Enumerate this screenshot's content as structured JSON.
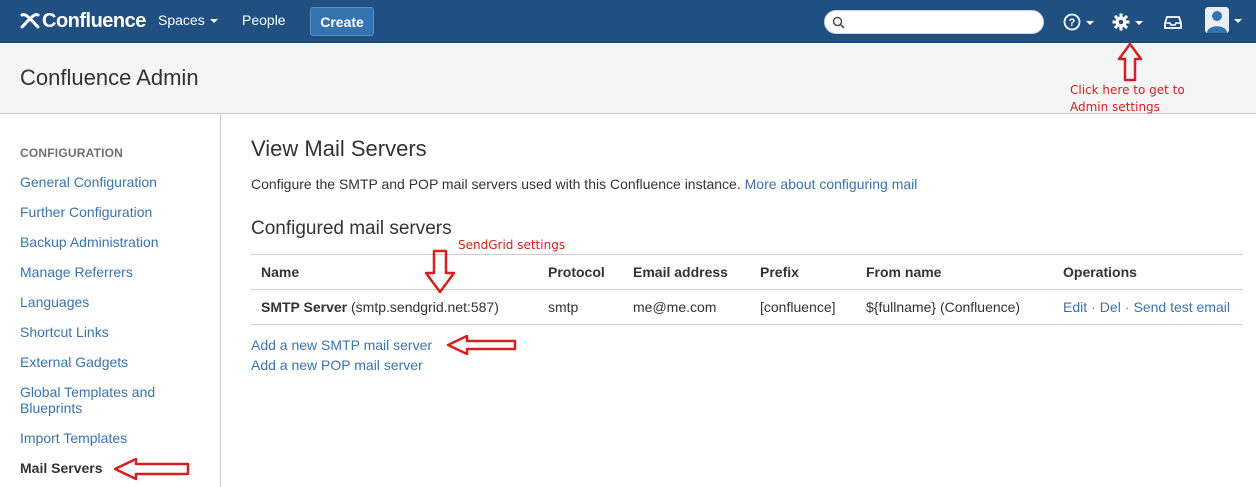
{
  "topnav": {
    "logo": "Confluence",
    "spaces": "Spaces",
    "people": "People",
    "create": "Create",
    "search_placeholder": ""
  },
  "header": {
    "title": "Confluence Admin"
  },
  "sidebar": {
    "heading": "CONFIGURATION",
    "items": [
      "General Configuration",
      "Further Configuration",
      "Backup Administration",
      "Manage Referrers",
      "Languages",
      "Shortcut Links",
      "External Gadgets",
      "Global Templates and Blueprints",
      "Import Templates",
      "Mail Servers"
    ]
  },
  "main": {
    "title": "View Mail Servers",
    "description": "Configure the SMTP and POP mail servers used with this Confluence instance.",
    "more_link": "More about configuring mail",
    "section_title": "Configured mail servers",
    "table": {
      "headers": [
        "Name",
        "Protocol",
        "Email address",
        "Prefix",
        "From name",
        "Operations"
      ],
      "rows": [
        {
          "name_bold": "SMTP Server",
          "name_detail": "(smtp.sendgrid.net:587)",
          "protocol": "smtp",
          "email": "me@me.com",
          "prefix": "[confluence]",
          "from_name": "${fullname} (Confluence)",
          "op_edit": "Edit",
          "op_del": "Del",
          "op_test": "Send test email"
        }
      ]
    },
    "add_smtp": "Add a new SMTP mail server",
    "add_pop": "Add a new POP mail server"
  },
  "annotations": {
    "sendgrid": "SendGrid settings",
    "admin_line1": "Click here to get to",
    "admin_line2": "Admin settings",
    "color": "#d42020"
  },
  "colors": {
    "nav_bg": "#205081",
    "link": "#3b73af",
    "create_bg": "#3572b0"
  }
}
